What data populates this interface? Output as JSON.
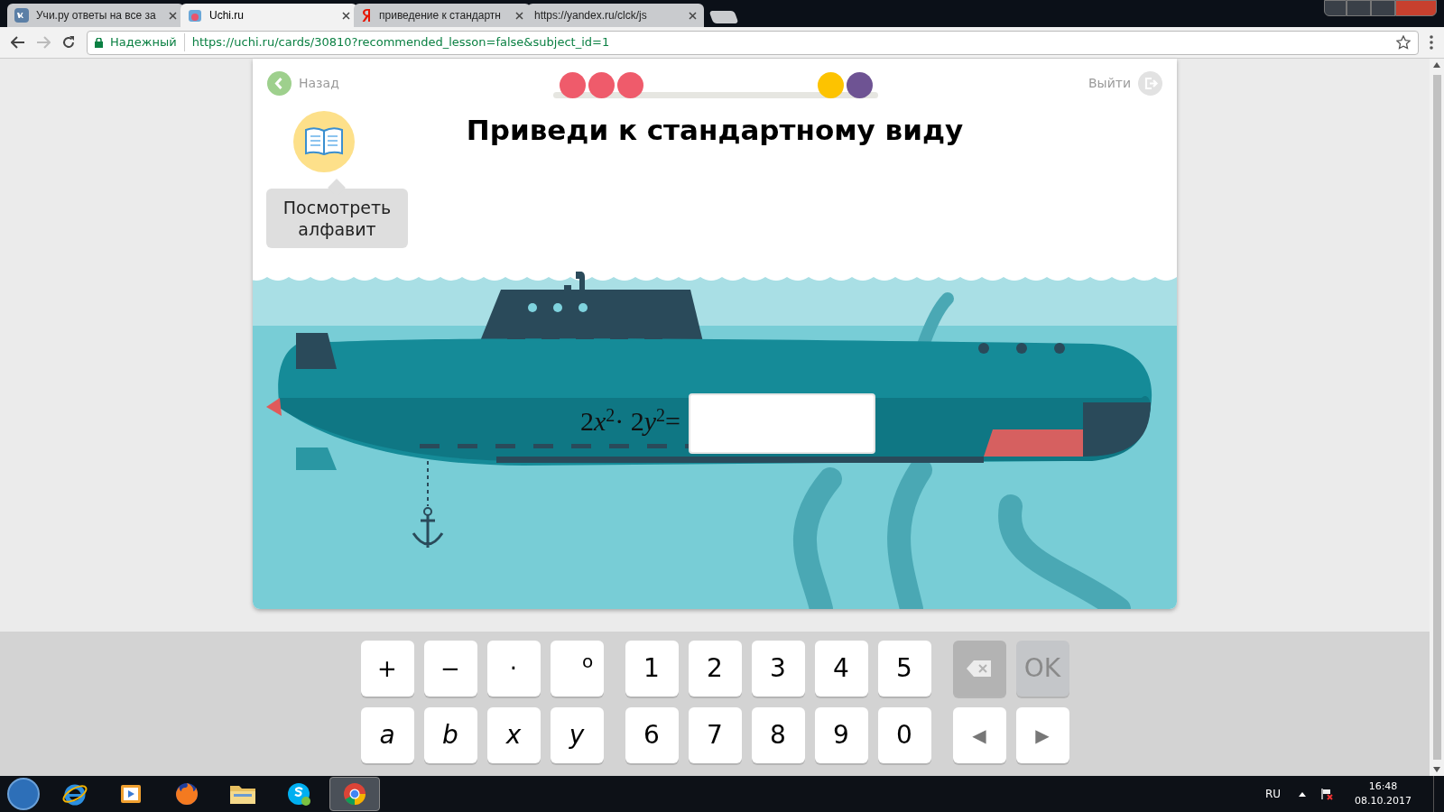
{
  "browser": {
    "tabs": [
      {
        "title": "Учи.ру ответы на все за",
        "kind": "vk",
        "selected": false
      },
      {
        "title": "Uchi.ru",
        "kind": "uchi",
        "selected": true
      },
      {
        "title": "приведение к стандартн",
        "kind": "yandex",
        "selected": false
      },
      {
        "title": "https://yandex.ru/clck/js",
        "kind": "plain",
        "selected": false
      }
    ],
    "security_label": "Надежный",
    "url": "https://uchi.ru/cards/30810?recommended_lesson=false&subject_id=1"
  },
  "card": {
    "back": "Назад",
    "exit": "Выйти",
    "progress": [
      {
        "color": "#ef5b6b"
      },
      {
        "color": "#ef5b6b"
      },
      {
        "color": "#ef5b6b"
      },
      {
        "color": "#fdc300"
      },
      {
        "color": "#6e5393"
      }
    ],
    "title": "Приведи к стандартному виду",
    "alphabet_hint": "Посмотреть алфавит",
    "equation": {
      "terms": [
        {
          "coefficient": "2",
          "variable": "x",
          "power": "2"
        },
        {
          "coefficient": "2",
          "variable": "y",
          "power": "2"
        }
      ],
      "operator": "·",
      "equals": "="
    }
  },
  "keyboard": [
    [
      {
        "kind": "symbol",
        "label": "+"
      },
      {
        "kind": "symbol",
        "label": "−"
      },
      {
        "kind": "symbol",
        "label": "·"
      },
      {
        "kind": "degree",
        "label": "o"
      },
      {
        "kind": "digit",
        "label": "1"
      },
      {
        "kind": "digit",
        "label": "2"
      },
      {
        "kind": "digit",
        "label": "3"
      },
      {
        "kind": "digit",
        "label": "4"
      },
      {
        "kind": "digit",
        "label": "5"
      },
      {
        "kind": "backspace",
        "disabled": true
      },
      {
        "kind": "ok",
        "label": "OK",
        "disabled": true
      }
    ],
    [
      {
        "kind": "variable",
        "label": "a"
      },
      {
        "kind": "variable",
        "label": "b"
      },
      {
        "kind": "variable",
        "label": "x"
      },
      {
        "kind": "variable",
        "label": "y"
      },
      {
        "kind": "digit",
        "label": "6"
      },
      {
        "kind": "digit",
        "label": "7"
      },
      {
        "kind": "digit",
        "label": "8"
      },
      {
        "kind": "digit",
        "label": "9"
      },
      {
        "kind": "digit",
        "label": "0"
      },
      {
        "kind": "arrow",
        "label": "◀"
      },
      {
        "kind": "arrow",
        "label": "▶"
      }
    ]
  ],
  "taskbar": {
    "apps": [
      {
        "kind": "ie",
        "active": false
      },
      {
        "kind": "media",
        "active": false
      },
      {
        "kind": "firefox",
        "active": false
      },
      {
        "kind": "folder",
        "active": false
      },
      {
        "kind": "skype",
        "active": false
      },
      {
        "kind": "chrome",
        "active": true
      }
    ],
    "language": "RU",
    "time": "16:48",
    "date": "08.10.2017"
  }
}
